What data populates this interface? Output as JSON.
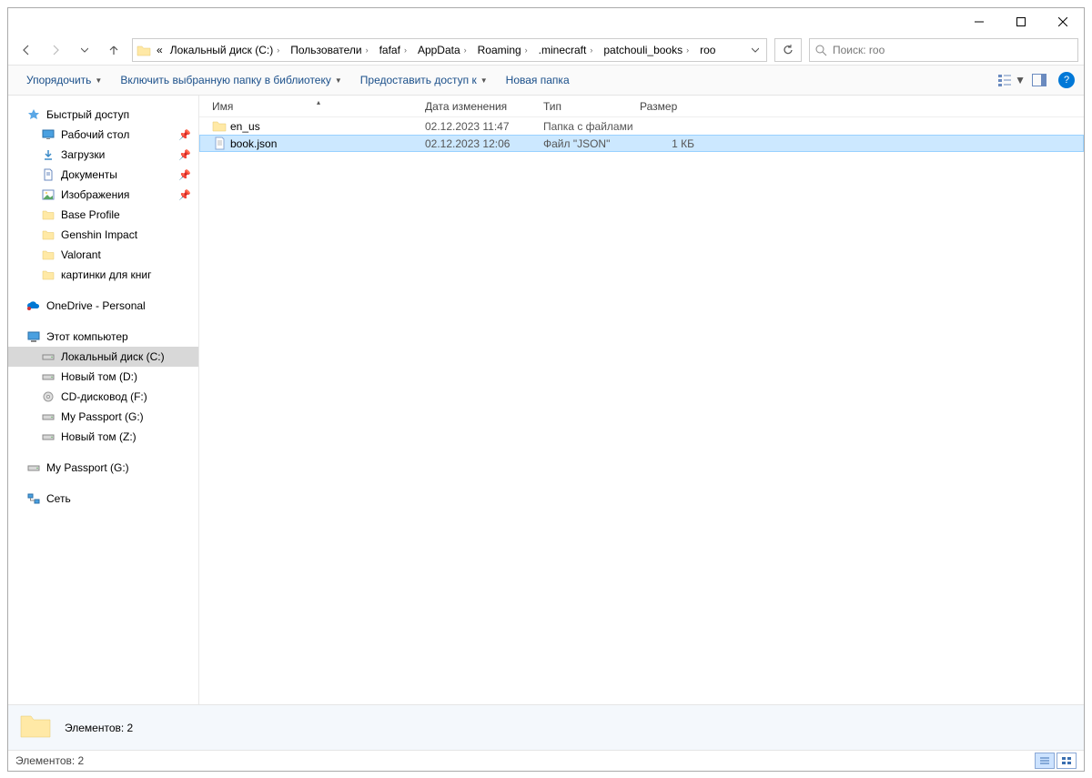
{
  "window": {
    "minimize": "",
    "maximize": "",
    "close": ""
  },
  "breadcrumb": {
    "overflow": "«",
    "items": [
      "Локальный диск (C:)",
      "Пользователи",
      "fafaf",
      "AppData",
      "Roaming",
      ".minecraft",
      "patchouli_books",
      "roo"
    ]
  },
  "search": {
    "placeholder": "Поиск: roo"
  },
  "toolbar": {
    "organize": "Упорядочить",
    "include": "Включить выбранную папку в библиотеку",
    "share": "Предоставить доступ к",
    "newfolder": "Новая папка"
  },
  "nav": {
    "quick": "Быстрый доступ",
    "quick_items": [
      {
        "label": "Рабочий стол",
        "icon": "desktop",
        "pin": true
      },
      {
        "label": "Загрузки",
        "icon": "download",
        "pin": true
      },
      {
        "label": "Документы",
        "icon": "doc",
        "pin": true
      },
      {
        "label": "Изображения",
        "icon": "pic",
        "pin": true
      },
      {
        "label": "Base Profile",
        "icon": "folder",
        "pin": false
      },
      {
        "label": "Genshin Impact",
        "icon": "folder",
        "pin": false
      },
      {
        "label": "Valorant",
        "icon": "folder",
        "pin": false
      },
      {
        "label": "картинки для книг",
        "icon": "folder",
        "pin": false
      }
    ],
    "onedrive": "OneDrive - Personal",
    "thispc": "Этот компьютер",
    "drives": [
      {
        "label": "Локальный диск (C:)",
        "sel": true
      },
      {
        "label": "Новый том (D:)",
        "sel": false
      },
      {
        "label": "CD-дисковод (F:)",
        "sel": false
      },
      {
        "label": "My Passport (G:)",
        "sel": false
      },
      {
        "label": "Новый том (Z:)",
        "sel": false
      }
    ],
    "extdrive": "My Passport (G:)",
    "network": "Сеть"
  },
  "columns": {
    "name": "Имя",
    "date": "Дата изменения",
    "type": "Тип",
    "size": "Размер"
  },
  "files": [
    {
      "name": "en_us",
      "date": "02.12.2023 11:47",
      "type": "Папка с файлами",
      "size": "",
      "icon": "folder",
      "sel": false
    },
    {
      "name": "book.json",
      "date": "02.12.2023 12:06",
      "type": "Файл \"JSON\"",
      "size": "1 КБ",
      "icon": "file",
      "sel": true
    }
  ],
  "details": {
    "count": "Элементов: 2"
  },
  "status": {
    "count": "Элементов: 2"
  }
}
